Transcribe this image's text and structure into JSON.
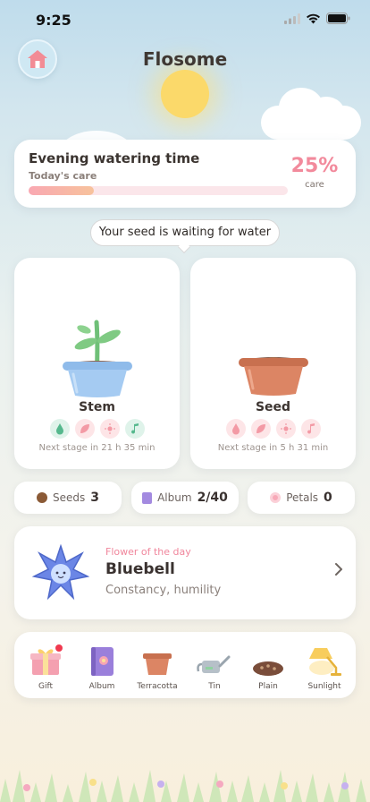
{
  "status": {
    "time": "9:25"
  },
  "app": {
    "title": "Flosome"
  },
  "care": {
    "title": "Evening watering time",
    "subtitle": "Today's care",
    "percent_text": "25%",
    "percent_label": "care",
    "progress": 0.25
  },
  "hint": "Your seed is waiting for water",
  "pots": [
    {
      "name": "Stem",
      "next": "Next stage in 21 h 35 min",
      "pot": "blue"
    },
    {
      "name": "Seed",
      "next": "Next stage in 5 h 31 min",
      "pot": "terracotta"
    }
  ],
  "stats": {
    "seeds_label": "Seeds",
    "seeds_value": "3",
    "album_label": "Album",
    "album_value": "2/40",
    "petals_label": "Petals",
    "petals_value": "0"
  },
  "flower_of_day": {
    "label": "Flower of the day",
    "name": "Bluebell",
    "meaning": "Constancy, humility"
  },
  "shelf": [
    "Gift",
    "Album",
    "Terracotta",
    "Tin",
    "Plain",
    "Sunlight"
  ],
  "colors": {
    "accent_pink": "#f28a9c",
    "sun": "#fbd96a",
    "blue_pot": "#9cc3ef",
    "terracotta_pot": "#d9805e",
    "stem_green": "#6fc078"
  },
  "icons": [
    "home-icon",
    "water-drop-icon",
    "leaf-icon",
    "sun-icon",
    "music-note-icon",
    "chevron-right-icon",
    "gift-icon",
    "album-book-icon",
    "seed-icon",
    "petal-icon"
  ]
}
